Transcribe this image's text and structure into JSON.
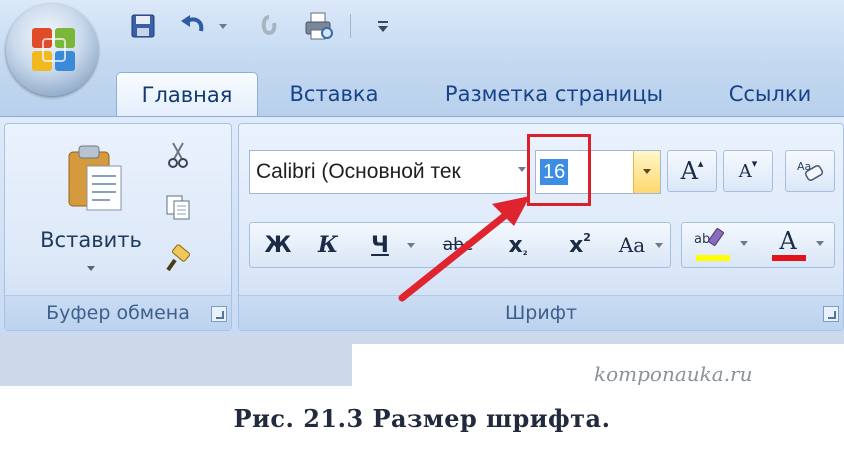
{
  "colors": {
    "highlight_frame": "#d9212b",
    "arrow": "#e0242f",
    "selection": "#3d8ee3",
    "text_highlight": "#ffff00",
    "font_color": "#e2131b"
  },
  "quick_access": {
    "icons": [
      "office-logo-icon",
      "save-icon",
      "undo-icon",
      "chevron-down-icon",
      "redo-icon",
      "print-preview-icon",
      "customize-toolbar-icon"
    ]
  },
  "tabs": [
    {
      "label": "Главная",
      "active": true
    },
    {
      "label": "Вставка",
      "active": false
    },
    {
      "label": "Разметка страницы",
      "active": false
    },
    {
      "label": "Ссылки",
      "active": false
    }
  ],
  "clipboard": {
    "paste_label": "Вставить",
    "group_label": "Буфер обмена"
  },
  "font": {
    "font_name": "Calibri (Основной тек",
    "font_size": "16",
    "group_label": "Шрифт",
    "grow_glyph": "A",
    "shrink_glyph": "A",
    "bold_glyph": "Ж",
    "italic_glyph": "К",
    "underline_glyph": "Ч",
    "strike_glyph": "abc",
    "sub_glyph": "x",
    "sub_mini": "₂",
    "sup_glyph": "x",
    "sup_mini": "2",
    "case_glyph": "Aa",
    "color_glyph": "A"
  },
  "watermark": "komponauka.ru",
  "caption": "Рис. 21.3  Размер шрифта."
}
